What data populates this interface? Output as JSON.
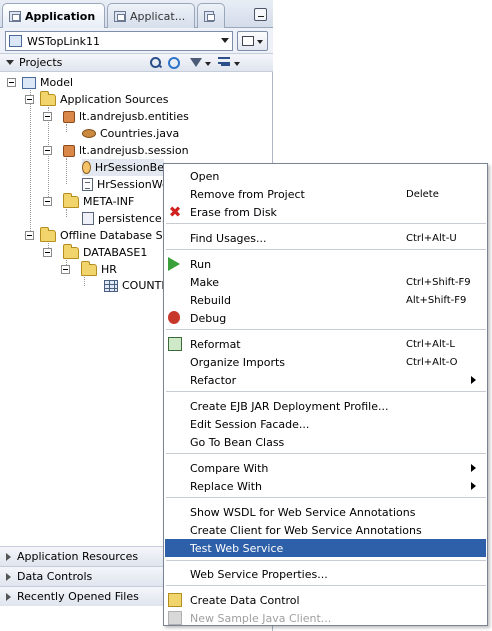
{
  "tabs": [
    {
      "label": "Application",
      "active": true
    },
    {
      "label": "Applicat...",
      "active": false
    },
    {
      "label": "",
      "active": false
    }
  ],
  "application_selector": {
    "value": "WSTopLink11"
  },
  "projects_header": {
    "label": "Projects"
  },
  "tree": [
    {
      "label": "Model",
      "icon": "model-icon"
    },
    {
      "label": "Application Sources",
      "icon": "folder-icon"
    },
    {
      "label": "lt.andrejusb.entities",
      "icon": "package-icon"
    },
    {
      "label": "Countries.java",
      "icon": "java-file-icon"
    },
    {
      "label": "lt.andrejusb.session",
      "icon": "package-icon"
    },
    {
      "label": "HrSessionBe",
      "icon": "session-bean-icon"
    },
    {
      "label": "HrSessionWe",
      "icon": "java-interface-icon"
    },
    {
      "label": "META-INF",
      "icon": "folder-icon"
    },
    {
      "label": "persistence.",
      "icon": "xml-file-icon"
    },
    {
      "label": "Offline Database Sou",
      "icon": "folder-icon"
    },
    {
      "label": "DATABASE1",
      "icon": "folder-icon"
    },
    {
      "label": "HR",
      "icon": "folder-icon"
    },
    {
      "label": "COUNTR",
      "icon": "table-icon"
    }
  ],
  "accordion": [
    {
      "label": "Application Resources"
    },
    {
      "label": "Data Controls"
    },
    {
      "label": "Recently Opened Files"
    }
  ],
  "context_menu": {
    "items": [
      {
        "label": "Open",
        "shortcut": "",
        "icon": ""
      },
      {
        "label": "Remove from Project",
        "shortcut": "Delete",
        "icon": ""
      },
      {
        "label": "Erase from Disk",
        "shortcut": "",
        "icon": "erase-icon"
      },
      {
        "label": "Find Usages...",
        "shortcut": "Ctrl+Alt-U",
        "icon": ""
      },
      {
        "label": "Run",
        "shortcut": "",
        "icon": "run-icon"
      },
      {
        "label": "Make",
        "shortcut": "Ctrl+Shift-F9",
        "icon": ""
      },
      {
        "label": "Rebuild",
        "shortcut": "Alt+Shift-F9",
        "icon": ""
      },
      {
        "label": "Debug",
        "shortcut": "",
        "icon": "debug-icon"
      },
      {
        "label": "Reformat",
        "shortcut": "Ctrl+Alt-L",
        "icon": "reformat-icon"
      },
      {
        "label": "Organize Imports",
        "shortcut": "Ctrl+Alt-O",
        "icon": ""
      },
      {
        "label": "Refactor",
        "shortcut": "",
        "icon": "",
        "submenu": true
      },
      {
        "label": "Create EJB JAR Deployment Profile...",
        "shortcut": "",
        "icon": ""
      },
      {
        "label": "Edit Session Facade...",
        "shortcut": "",
        "icon": ""
      },
      {
        "label": "Go To Bean Class",
        "shortcut": "",
        "icon": ""
      },
      {
        "label": "Compare With",
        "shortcut": "",
        "icon": "",
        "submenu": true
      },
      {
        "label": "Replace With",
        "shortcut": "",
        "icon": "",
        "submenu": true
      },
      {
        "label": "Show WSDL for Web Service Annotations",
        "shortcut": "",
        "icon": ""
      },
      {
        "label": "Create Client for Web Service Annotations",
        "shortcut": "",
        "icon": ""
      },
      {
        "label": "Test Web Service",
        "shortcut": "",
        "icon": "",
        "highlighted": true
      },
      {
        "label": "Web Service Properties...",
        "shortcut": "",
        "icon": ""
      },
      {
        "label": "Create Data Control",
        "shortcut": "",
        "icon": "data-control-icon"
      },
      {
        "label": "New Sample Java Client...",
        "shortcut": "",
        "icon": "sample-client-icon",
        "disabled": true
      }
    ]
  },
  "colors": {
    "menu_highlight": "#2e5fa9",
    "panel_header": "#dfe5ee",
    "folder": "#f2d46c"
  }
}
